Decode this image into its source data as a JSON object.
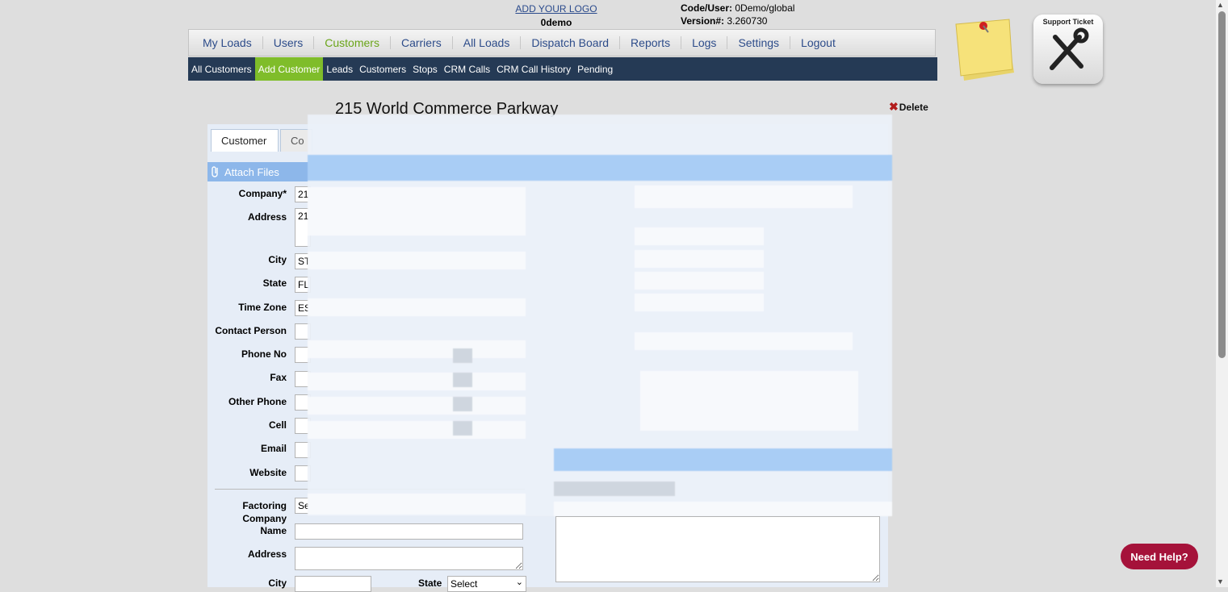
{
  "header": {
    "logo_link": "ADD YOUR LOGO",
    "company_code": "0demo",
    "code_user_label": "Code/User:",
    "code_user_value": "0Demo/global",
    "version_label": "Version#:",
    "version_value": "3.260730"
  },
  "main_nav": [
    {
      "label": "My Loads"
    },
    {
      "label": "Users"
    },
    {
      "label": "Customers"
    },
    {
      "label": "Carriers"
    },
    {
      "label": "All Loads"
    },
    {
      "label": "Dispatch Board"
    },
    {
      "label": "Reports"
    },
    {
      "label": "Logs"
    },
    {
      "label": "Settings"
    },
    {
      "label": "Logout"
    }
  ],
  "main_nav_active": "Customers",
  "sub_nav": [
    {
      "label": "All Customers"
    },
    {
      "label": "Add Customer"
    },
    {
      "label": "Leads"
    },
    {
      "label": "Customers"
    },
    {
      "label": "Stops"
    },
    {
      "label": "CRM Calls"
    },
    {
      "label": "CRM Call History"
    },
    {
      "label": "Pending"
    }
  ],
  "sub_nav_active": "Add Customer",
  "support_ticket": {
    "label": "Support Ticket",
    "icon": "wrench-screwdriver-icon"
  },
  "sticky_note": {
    "icon": "sticky-note-icon"
  },
  "page": {
    "title": "215 World Commerce Parkway",
    "delete_label": "Delete"
  },
  "tabs": {
    "customer": "Customer",
    "second": "Co"
  },
  "attach_files": "Attach Files",
  "form": {
    "company_label": "Company*",
    "company_value": "21",
    "address_label": "Address",
    "address_value": "21",
    "city_label": "City",
    "city_value": "ST",
    "state_label": "State",
    "state_value": "FL",
    "timezone_label": "Time Zone",
    "timezone_value": "ES",
    "contact_label": "Contact Person",
    "phone_label": "Phone No",
    "fax_label": "Fax",
    "other_phone_label": "Other Phone",
    "cell_label": "Cell",
    "email_label": "Email",
    "website_label": "Website",
    "factoring_label": "Factoring Company",
    "factoring_value": "Se",
    "name_label": "Name",
    "address2_label": "Address",
    "city2_label": "City",
    "state2_label": "State",
    "state2_select": "Select"
  },
  "need_help": "Need Help?",
  "colors": {
    "nav_active": "#6aa519",
    "subnav_bg": "#253a55",
    "subnav_active": "#7fbd2a",
    "attach_bar": "#8db7ea",
    "need_help": "#a5123a",
    "delete_x": "#b21c1c"
  }
}
